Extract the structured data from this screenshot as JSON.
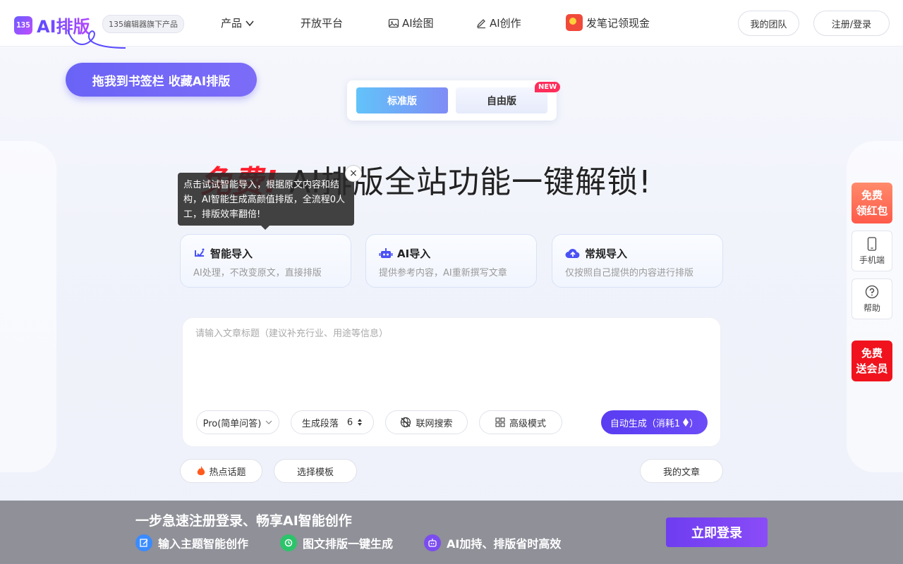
{
  "header": {
    "logo_mark": "135",
    "logo_text": "AI排版",
    "logo_badge": "135编辑器旗下产品",
    "nav": [
      {
        "label": "产品",
        "icon": "chevron-down-icon"
      },
      {
        "label": "开放平台"
      },
      {
        "label": "AI绘图",
        "icon": "image-icon"
      },
      {
        "label": "AI创作",
        "icon": "pen-icon"
      },
      {
        "label": "发笔记领现金",
        "icon": "red-envelope-icon"
      }
    ],
    "team_button": "我的团队",
    "login_button": "注册/登录"
  },
  "bookmark_button": "拖我到书签栏 收藏AI排版",
  "version_switch": {
    "standard": "标准版",
    "free": "自由版",
    "new_badge": "NEW"
  },
  "hero": {
    "highlight": "免费!",
    "rest": " AI排版全站功能一键解锁!"
  },
  "tooltip": {
    "text": "点击试试智能导入，根据原文内容和结构，AI智能生成高颜值排版，全流程0人工，排版效率翻倍!",
    "close": "×"
  },
  "import_cards": [
    {
      "title": "智能导入",
      "desc": "AI处理，不改变原文，直接排版",
      "icon": "smart-import-icon"
    },
    {
      "title": "AI导入",
      "desc": "提供参考内容，AI重新撰写文章",
      "icon": "robot-icon"
    },
    {
      "title": "常规导入",
      "desc": "仅按照自己提供的内容进行排版",
      "icon": "cloud-upload-icon"
    }
  ],
  "input_panel": {
    "placeholder": "请输入文章标题（建议补充行业、用途等信息）",
    "model_select": "Pro(简单问答)",
    "paragraphs_label": "生成段落",
    "paragraphs_value": "6",
    "web_search": "联网搜索",
    "advanced_mode": "高级模式",
    "generate_button": "自动生成（消耗1"
  },
  "bottom_actions": {
    "hot_topics": "热点话题",
    "choose_template": "选择模板",
    "my_articles": "我的文章"
  },
  "float_panel": {
    "red_envelope": [
      "免费",
      "领红包"
    ],
    "mobile": "手机端",
    "help": "帮助",
    "free_vip": [
      "免费",
      "送会员"
    ]
  },
  "banner": {
    "title": "一步急速注册登录、畅享AI智能创作",
    "features": [
      {
        "label": "输入主题智能创作",
        "color": "#3a8bff"
      },
      {
        "label": "图文排版一键生成",
        "color": "#2bc46a"
      },
      {
        "label": "AI加持、排版省时高效",
        "color": "#7b4cf0"
      }
    ],
    "login_button": "立即登录"
  }
}
